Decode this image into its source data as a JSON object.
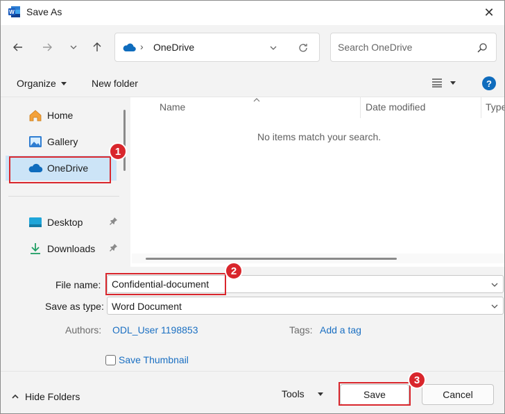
{
  "window": {
    "title": "Save As",
    "close_label": "✕"
  },
  "address": {
    "location": "OneDrive",
    "separator": "›"
  },
  "search": {
    "placeholder": "Search OneDrive"
  },
  "toolbar": {
    "organize_label": "Organize",
    "new_folder_label": "New folder",
    "help_label": "?"
  },
  "sidebar": {
    "items": [
      {
        "label": "Home",
        "icon": "home-icon"
      },
      {
        "label": "Gallery",
        "icon": "gallery-icon"
      },
      {
        "label": "OneDrive",
        "icon": "cloud-icon",
        "selected": true
      },
      {
        "label": "Desktop",
        "icon": "desktop-icon",
        "pinned": true
      },
      {
        "label": "Downloads",
        "icon": "download-icon",
        "pinned": true
      }
    ]
  },
  "filelist": {
    "columns": [
      "Name",
      "Date modified",
      "Type"
    ],
    "empty_message": "No items match your search."
  },
  "form": {
    "file_name_label": "File name:",
    "file_name_value": "Confidential-document",
    "save_type_label": "Save as type:",
    "save_type_value": "Word Document",
    "authors_label": "Authors:",
    "authors_value": "ODL_User 1198853",
    "tags_label": "Tags:",
    "tags_value": "Add a tag",
    "thumbnail_label": "Save Thumbnail",
    "thumbnail_checked": false
  },
  "footer": {
    "hide_folders_label": "Hide Folders",
    "tools_label": "Tools",
    "save_label": "Save",
    "cancel_label": "Cancel"
  },
  "annotations": {
    "step1": "1",
    "step2": "2",
    "step3": "3",
    "color": "#d9262c"
  },
  "colors": {
    "accent": "#0067c0",
    "selection": "#cce4f7",
    "link": "#1a6fc2"
  }
}
